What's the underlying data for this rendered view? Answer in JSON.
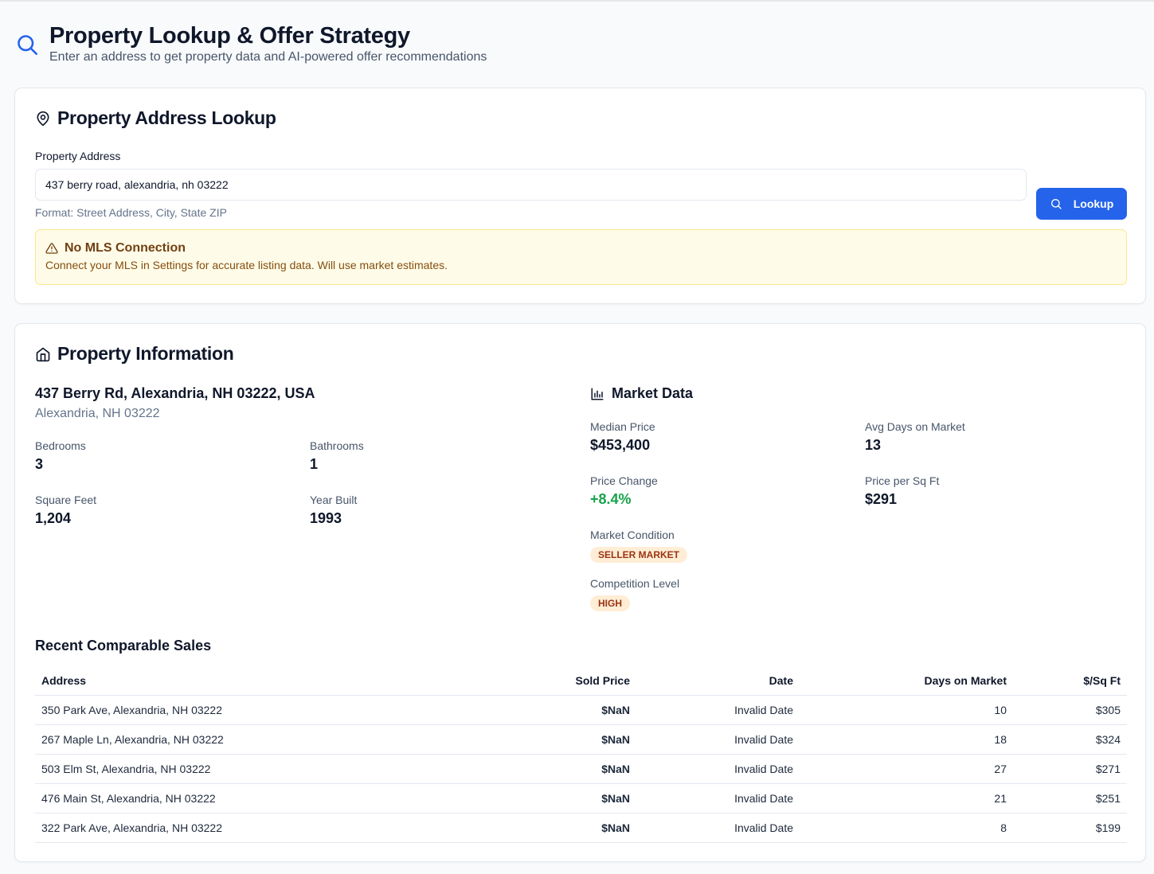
{
  "header": {
    "title": "Property Lookup & Offer Strategy",
    "subtitle": "Enter an address to get property data and AI-powered offer recommendations",
    "icon": "search-icon"
  },
  "lookup": {
    "title": "Property Address Lookup",
    "field_label": "Property Address",
    "address_value": "437 berry road, alexandria, nh 03222",
    "hint": "Format: Street Address, City, State ZIP",
    "button_label": "Lookup",
    "accent": "#2563eb"
  },
  "alert": {
    "title": "No MLS Connection",
    "message": "Connect your MLS in Settings for accurate listing data. Will use market estimates."
  },
  "property": {
    "title": "Property Information",
    "address": "437 Berry Rd, Alexandria, NH 03222, USA",
    "city": "Alexandria, NH 03222",
    "bedrooms_label": "Bedrooms",
    "bedrooms": "3",
    "bathrooms_label": "Bathrooms",
    "bathrooms": "1",
    "sqft_label": "Square Feet",
    "sqft": "1,204",
    "year_label": "Year Built",
    "year": "1993"
  },
  "market": {
    "title": "Market Data",
    "median_label": "Median Price",
    "median": "$453,400",
    "dom_label": "Avg Days on Market",
    "dom": "13",
    "change_label": "Price Change",
    "change": "+8.4%",
    "ppsf_label": "Price per Sq Ft",
    "ppsf": "$291",
    "condition_label": "Market Condition",
    "condition": "SELLER MARKET",
    "competition_label": "Competition Level",
    "competition": "HIGH"
  },
  "comps": {
    "title": "Recent Comparable Sales",
    "headers": [
      "Address",
      "Sold Price",
      "Date",
      "Days on Market",
      "$/Sq Ft"
    ],
    "rows": [
      [
        "350 Park Ave, Alexandria, NH 03222",
        "$NaN",
        "Invalid Date",
        "10",
        "$305"
      ],
      [
        "267 Maple Ln, Alexandria, NH 03222",
        "$NaN",
        "Invalid Date",
        "18",
        "$324"
      ],
      [
        "503 Elm St, Alexandria, NH 03222",
        "$NaN",
        "Invalid Date",
        "27",
        "$271"
      ],
      [
        "476 Main St, Alexandria, NH 03222",
        "$NaN",
        "Invalid Date",
        "21",
        "$251"
      ],
      [
        "322 Park Ave, Alexandria, NH 03222",
        "$NaN",
        "Invalid Date",
        "8",
        "$199"
      ]
    ]
  }
}
